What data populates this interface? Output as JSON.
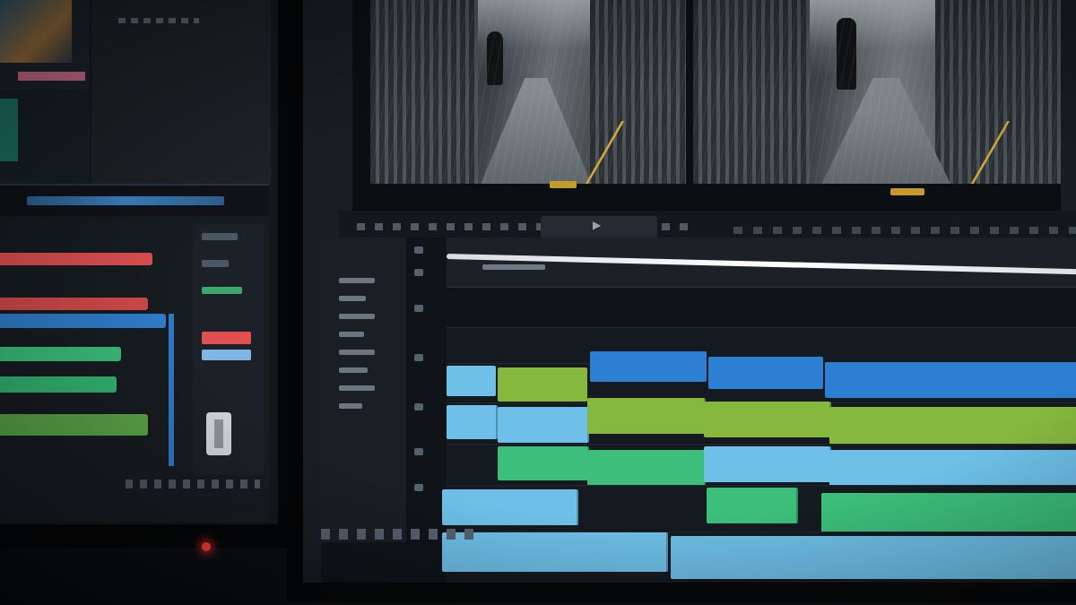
{
  "scene": {
    "description_colors": {
      "clip_blue": "#2d7fd3",
      "clip_light_blue": "#6ec0e8",
      "clip_green": "#86b83e",
      "clip_teal": "#3cbf7a",
      "left_track_red": "#e05050",
      "left_track_green": "#3bbf7b",
      "timecode_amber": "#c49a2a",
      "power_led": "#ff3a3a"
    },
    "icons": [
      "play-icon"
    ]
  },
  "main_monitor": {
    "preview": {
      "frames": [
        "rainy-street-frame-left",
        "rainy-street-frame-right"
      ]
    },
    "timeline": {
      "clip_labels": [
        "",
        "",
        "",
        ""
      ]
    }
  }
}
